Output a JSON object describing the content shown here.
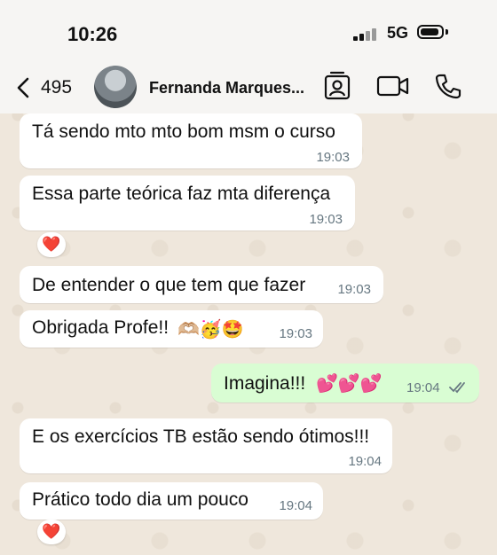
{
  "status_bar": {
    "time": "10:26",
    "network": "5G"
  },
  "header": {
    "back_count": "495",
    "contact_name": "Fernanda Marques..."
  },
  "messages": [
    {
      "text": "Tá sendo mto mto bom msm o curso",
      "time": "19:03",
      "direction": "in"
    },
    {
      "text": "Essa parte teórica faz mta diferença",
      "time": "19:03",
      "direction": "in",
      "reaction": "❤️"
    },
    {
      "text": "De entender o que tem que fazer",
      "time": "19:03",
      "direction": "in"
    },
    {
      "text": "Obrigada Profe!!",
      "emojis": "🫶🏼🥳🤩",
      "time": "19:03",
      "direction": "in"
    },
    {
      "text": "Imagina!!!",
      "emojis": "💕💕💕",
      "time": "19:04",
      "direction": "out",
      "status": "read"
    },
    {
      "text": "E os exercícios TB estão sendo ótimos!!!",
      "time": "19:04",
      "direction": "in"
    },
    {
      "text": "Prático todo dia um pouco",
      "time": "19:04",
      "direction": "in",
      "reaction": "❤️"
    }
  ],
  "colors": {
    "incoming_bubble": "#ffffff",
    "outgoing_bubble": "#d9fdd3",
    "read_ticks": "#53bdeb",
    "chat_bg": "#efe7dc"
  },
  "icons": [
    "back-chevron-icon",
    "contact-card-icon",
    "video-call-icon",
    "phone-icon",
    "double-check-icon"
  ]
}
